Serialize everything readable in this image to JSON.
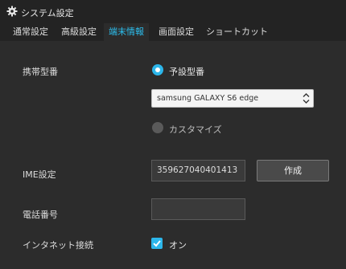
{
  "window": {
    "title": "システム設定",
    "icon": "gear-icon"
  },
  "tabs": [
    {
      "label": "通常設定",
      "active": false
    },
    {
      "label": "高級設定",
      "active": false
    },
    {
      "label": "端末情報",
      "active": true
    },
    {
      "label": "画面設定",
      "active": false
    },
    {
      "label": "ショートカット",
      "active": false
    }
  ],
  "device_model": {
    "label": "携帯型番",
    "preset_option": "予設型番",
    "preset_selected": true,
    "select_value": "samsung GALAXY S6 edge",
    "custom_option": "カスタマイズ",
    "custom_selected": false
  },
  "ime": {
    "label": "IME設定",
    "value": "359627040401413",
    "generate_button": "作成"
  },
  "phone": {
    "label": "電話番号",
    "value": ""
  },
  "internet": {
    "label": "インタネット接続",
    "checkbox_label": "オン",
    "checked": true
  },
  "colors": {
    "accent": "#2cc0f0",
    "background": "#2c2c2c",
    "titlebar": "#232323"
  }
}
